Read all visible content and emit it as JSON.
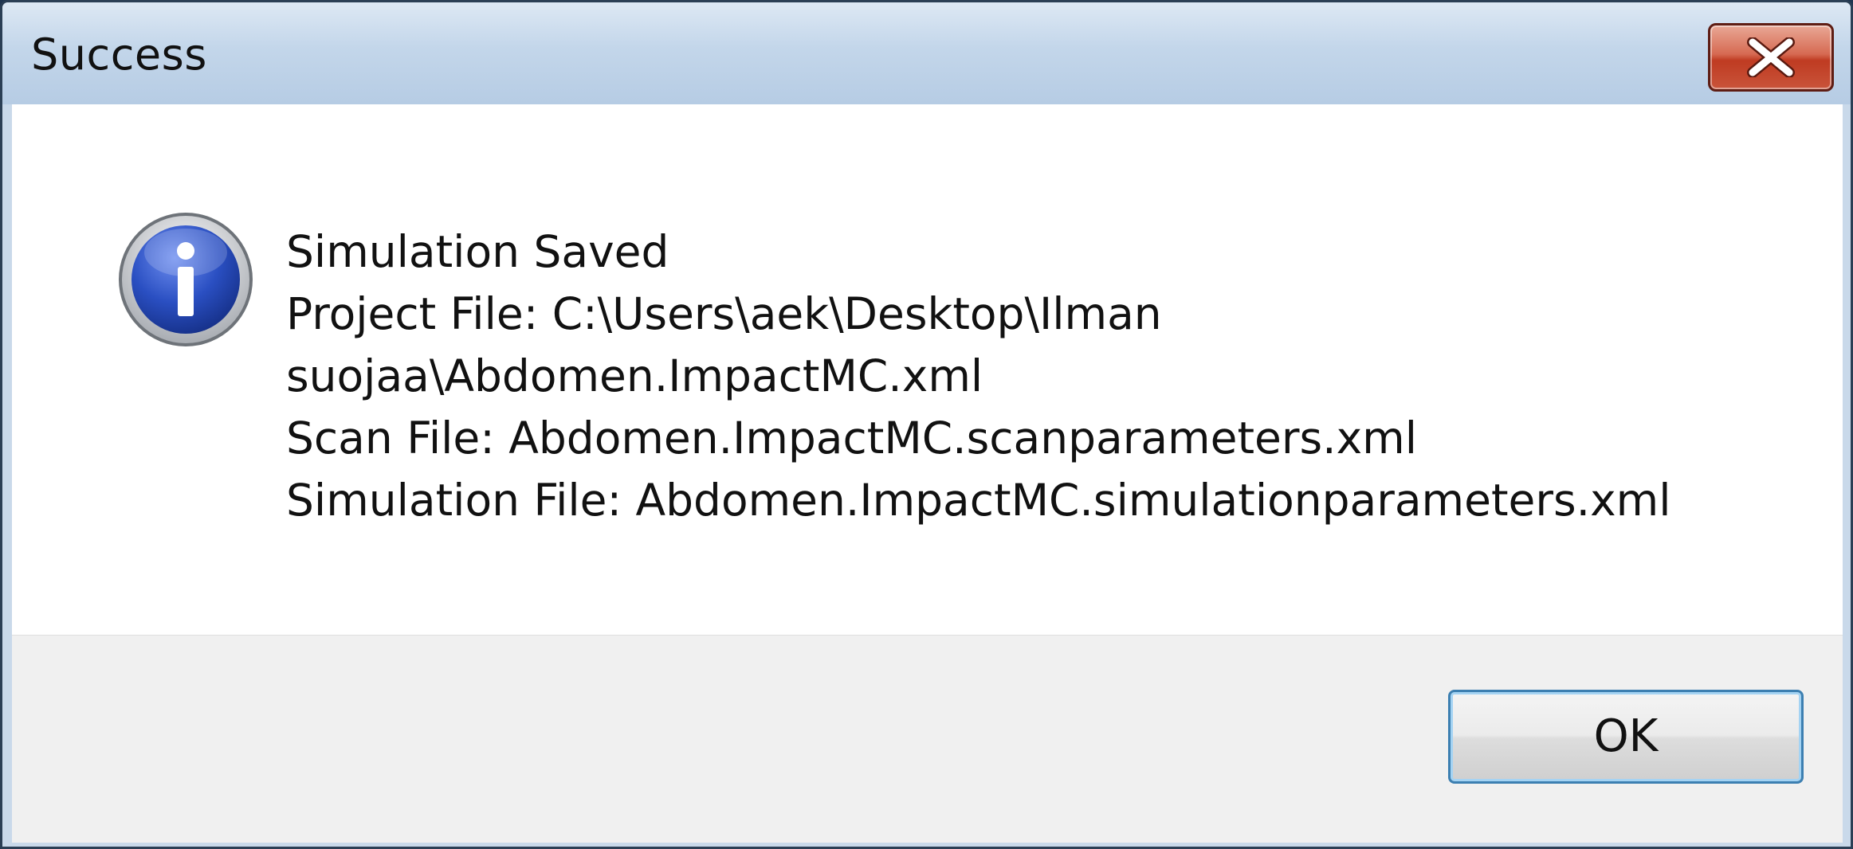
{
  "dialog": {
    "title": "Success",
    "message_lines": [
      "Simulation Saved",
      "Project File: C:\\Users\\aek\\Desktop\\Ilman",
      "suojaa\\Abdomen.ImpactMC.xml",
      "Scan File: Abdomen.ImpactMC.scanparameters.xml",
      "Simulation File: Abdomen.ImpactMC.simulationparameters.xml"
    ],
    "ok_label": "OK",
    "icon": "info-icon",
    "close_icon": "close-icon"
  },
  "colors": {
    "titlebar": "#c3d6ea",
    "close_button": "#c9543a",
    "info_icon_blue": "#2a4fc2",
    "footer": "#f0f0f0",
    "ok_border": "#3c7fb1"
  }
}
